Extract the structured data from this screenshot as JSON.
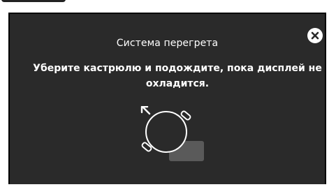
{
  "dialog": {
    "title": "Система перегрета",
    "message": "Уберите кастрюлю и подождите, пока дисплей не охладится.",
    "close_icon": "close-icon",
    "illustration_icon": "pot-remove-from-burner-icon"
  },
  "colors": {
    "dialog_background": "#2a2a2a",
    "text": "#ffffff",
    "burner_zone": "#5a5a5a"
  }
}
